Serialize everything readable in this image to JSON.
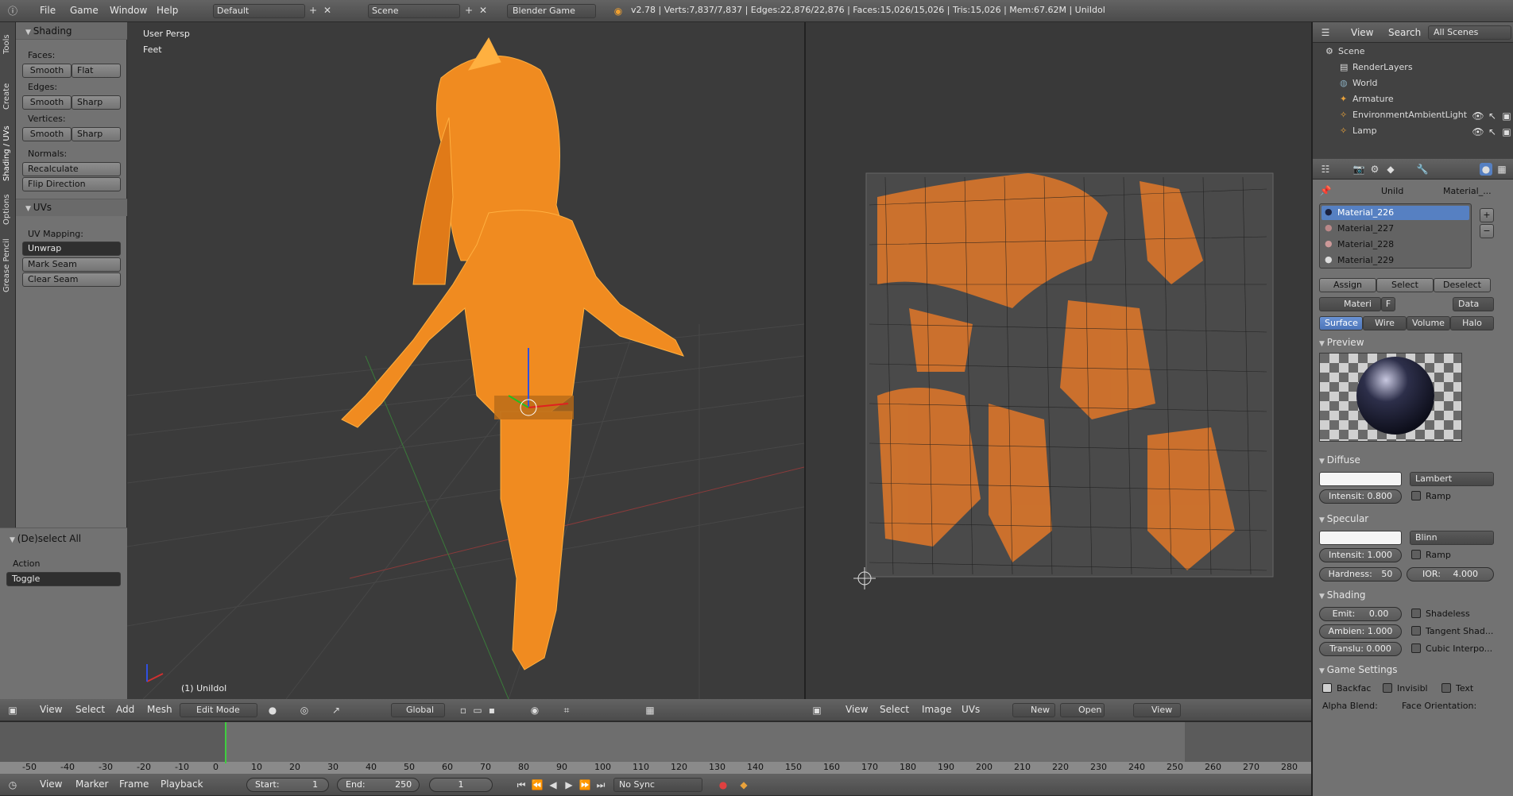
{
  "top_bar": {
    "menus": [
      "File",
      "Game",
      "Window",
      "Help"
    ],
    "layout": "Default",
    "scene": "Scene",
    "engine": "Blender Game",
    "stats": "v2.78 | Verts:7,837/7,837 | Edges:22,876/22,876 | Faces:15,026/15,026 | Tris:15,026 | Mem:67.62M | UniIdol"
  },
  "vtabs": [
    "Tools",
    "Create",
    "Shading / UVs",
    "Options",
    "Grease Pencil"
  ],
  "tool_shelf": {
    "shading_title": "Shading",
    "faces_label": "Faces:",
    "edges_label": "Edges:",
    "vertices_label": "Vertices:",
    "smooth": "Smooth",
    "flat": "Flat",
    "sharp": "Sharp",
    "normals_label": "Normals:",
    "recalculate": "Recalculate",
    "flip": "Flip Direction",
    "uvs_title": "UVs",
    "uv_mapping_label": "UV Mapping:",
    "unwrap": "Unwrap",
    "mark_seam": "Mark Seam",
    "clear_seam": "Clear Seam",
    "operator_title": "(De)select All",
    "action_label": "Action",
    "action_value": "Toggle"
  },
  "viewport": {
    "view_name": "User Persp",
    "units": "Feet",
    "object_label": "(1) UniIdol",
    "menus": [
      "View",
      "Select",
      "Add",
      "Mesh"
    ],
    "mode": "Edit Mode",
    "orientation": "Global"
  },
  "uv_editor": {
    "menus": [
      "View",
      "Select",
      "Image",
      "UVs"
    ],
    "new_label": "New",
    "open_label": "Open",
    "view_label": "View"
  },
  "outliner": {
    "menus": [
      "View",
      "Search"
    ],
    "scope": "All Scenes",
    "items": [
      "Scene",
      "RenderLayers",
      "World",
      "Armature",
      "EnvironmentAmbientLight",
      "Lamp"
    ]
  },
  "properties": {
    "breadcrumb_object": "UniId",
    "breadcrumb_material": "Material_...",
    "materials": [
      "Material_226",
      "Material_227",
      "Material_228",
      "Material_229"
    ],
    "assign": "Assign",
    "select": "Select",
    "deselect": "Deselect",
    "mat_field": "Materi",
    "mat_f": "F",
    "data_label": "Data",
    "tabs": [
      "Surface",
      "Wire",
      "Volume",
      "Halo"
    ],
    "preview_title": "Preview",
    "diffuse_title": "Diffuse",
    "diffuse_shader": "Lambert",
    "diffuse_intensity": "Intensit: 0.800",
    "ramp": "Ramp",
    "specular_title": "Specular",
    "specular_shader": "Blinn",
    "specular_intensity": "Intensit: 1.000",
    "hardness": "Hardness:",
    "hardness_val": "50",
    "ior": "IOR:",
    "ior_val": "4.000",
    "shading_title": "Shading",
    "emit": "Emit:",
    "emit_val": "0.00",
    "ambient": "Ambien: 1.000",
    "translucency": "Translu: 0.000",
    "shadeless": "Shadeless",
    "tangent": "Tangent Shad...",
    "cubic": "Cubic Interpo...",
    "game_title": "Game Settings",
    "backface": "Backfac",
    "invisible": "Invisibl",
    "text": "Text",
    "alpha_blend": "Alpha Blend:",
    "face_orientation": "Face Orientation:"
  },
  "timeline": {
    "ticks": [
      "-50",
      "-40",
      "-30",
      "-20",
      "-10",
      "0",
      "10",
      "20",
      "30",
      "40",
      "50",
      "60",
      "70",
      "80",
      "90",
      "100",
      "110",
      "120",
      "130",
      "140",
      "150",
      "160",
      "170",
      "180",
      "190",
      "200",
      "210",
      "220",
      "230",
      "240",
      "250",
      "260",
      "270",
      "280"
    ],
    "current_frame": 1,
    "menus": [
      "View",
      "Marker",
      "Frame",
      "Playback"
    ],
    "start_label": "Start:",
    "start_val": "1",
    "end_label": "End:",
    "end_val": "250",
    "frame_val": "1",
    "sync": "No Sync"
  },
  "colors": {
    "accent": "#5680c2",
    "wire": "#ff8a1c",
    "timeline_cursor": "#3fce3f"
  }
}
